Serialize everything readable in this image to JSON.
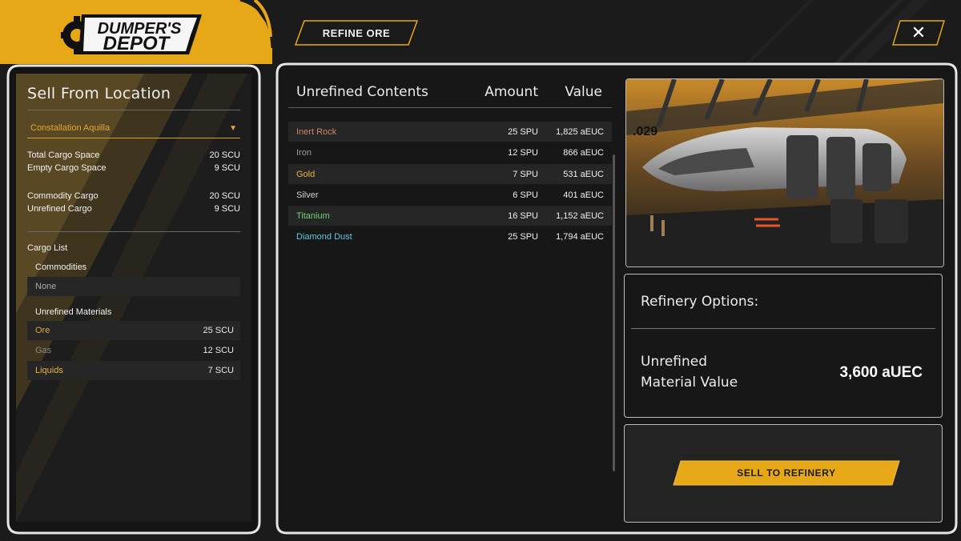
{
  "app": {
    "logo_text": [
      "DUMPER'S",
      "DEPOT"
    ]
  },
  "toolbar": {
    "refine_label": "REFINE ORE",
    "close_label": "✕"
  },
  "sell_panel": {
    "title": "Sell From Location",
    "location": "Constallation Aquilla",
    "stats": [
      {
        "label": "Total Cargo Space",
        "value": "20 SCU"
      },
      {
        "label": "Empty Cargo Space",
        "value": "9 SCU"
      }
    ],
    "cargo_stats": [
      {
        "label": "Commodity Cargo",
        "value": "20 SCU"
      },
      {
        "label": "Unrefined Cargo",
        "value": "9 SCU"
      }
    ],
    "cargo_list_title": "Cargo List",
    "commodities_title": "Commodities",
    "commodities_empty": "None",
    "unrefined_title": "Unrefined Materials",
    "unrefined": [
      {
        "name": "Ore",
        "value": "25 SCU",
        "color": "#e2a636"
      },
      {
        "name": "Gas",
        "value": "12 SCU",
        "color": "#8a8a8a"
      },
      {
        "name": "Liquids",
        "value": "7 SCU",
        "color": "#e8b440"
      }
    ]
  },
  "contents": {
    "headers": [
      "Unrefined Contents",
      "Amount",
      "Value"
    ],
    "rows": [
      {
        "name": "Inert Rock",
        "amount": "25 SPU",
        "value": "1,825 aEUC",
        "color": "#c9866a"
      },
      {
        "name": "Iron",
        "amount": "12 SPU",
        "value": "866 aEUC",
        "color": "#9a9a9a"
      },
      {
        "name": "Gold",
        "amount": "7 SPU",
        "value": "531 aEUC",
        "color": "#e8b440"
      },
      {
        "name": "Silver",
        "amount": "6 SPU",
        "value": "401 aEUC",
        "color": "#cfcfcf"
      },
      {
        "name": "Titanium",
        "amount": "16 SPU",
        "value": "1,152 aEUC",
        "color": "#6fd46f"
      },
      {
        "name": "Diamond Dust",
        "amount": "25 SPU",
        "value": "1,794 aEUC",
        "color": "#5fc9e0"
      }
    ]
  },
  "refinery": {
    "title": "Refinery Options:",
    "label_line1": "Unrefined",
    "label_line2": "Material Value",
    "value": "3,600 aUEC",
    "sell_label": "SELL TO REFINERY"
  },
  "ship_image": {
    "hull_marking": ".029"
  },
  "colors": {
    "accent": "#e6a817",
    "panel_border": "#bdbdbd",
    "background": "#1b1b1b"
  }
}
